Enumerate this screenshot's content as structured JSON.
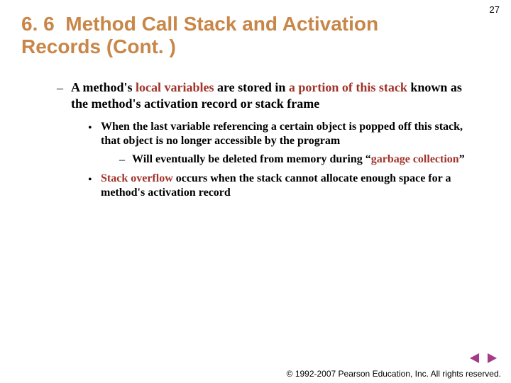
{
  "page_number": "27",
  "title": {
    "section_number": "6. 6",
    "text": "Method Call Stack and Activation Records (Cont. )"
  },
  "body": {
    "level1": {
      "pre": "A method's ",
      "em1": "local variables",
      "mid": " are stored in ",
      "em2": "a portion of this stack",
      "post": " known as the method's activation record or stack frame"
    },
    "level2a": "When the last variable referencing a certain object is popped off this stack, that object is no longer accessible by the program",
    "level3": {
      "pre": "Will eventually be deleted from memory during “",
      "em": "garbage collection",
      "post": "”"
    },
    "level2b": {
      "em": "Stack overflow",
      "post": " occurs when the stack cannot allocate enough space for a method's activation record"
    }
  },
  "bullets": {
    "dash": "–",
    "dot": "•"
  },
  "footer": "© 1992-2007 Pearson Education, Inc. All rights reserved.",
  "nav": {
    "prev_color": "#a43a8a",
    "next_color": "#a43a8a"
  }
}
